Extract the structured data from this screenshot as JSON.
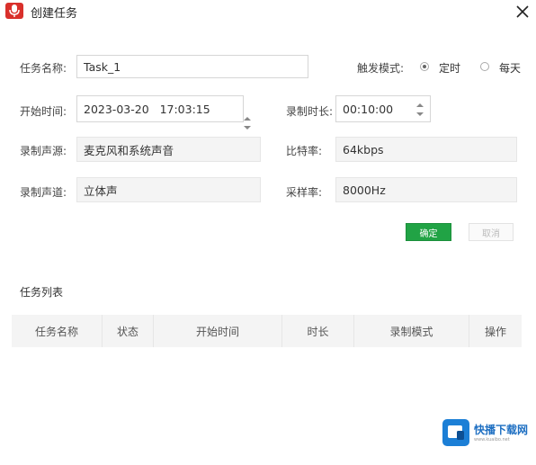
{
  "window": {
    "title": "创建任务"
  },
  "form": {
    "task_name": {
      "label": "任务名称:",
      "value": "Task_1"
    },
    "trigger": {
      "label": "触发模式:",
      "options": [
        "定时",
        "每天"
      ],
      "selected": "定时"
    },
    "start_time": {
      "label": "开始时间:",
      "value": "2023-03-20   17:03:15"
    },
    "duration": {
      "label": "录制时长:",
      "value": "00:10:00"
    },
    "source": {
      "label": "录制声源:",
      "value": "麦克风和系统声音"
    },
    "bitrate": {
      "label": "比特率:",
      "value": "64kbps"
    },
    "channel": {
      "label": "录制声道:",
      "value": "立体声"
    },
    "samplerate": {
      "label": "采样率:",
      "value": "8000Hz"
    }
  },
  "buttons": {
    "ok": "确定",
    "cancel": "取消"
  },
  "task_list": {
    "title": "任务列表",
    "columns": [
      "任务名称",
      "状态",
      "开始时间",
      "时长",
      "录制模式",
      "操作"
    ]
  },
  "watermark": {
    "name": "快播下载网",
    "url": "www.kuaibo.net"
  },
  "colors": {
    "accent_green": "#21a345",
    "app_red": "#d9302b",
    "watermark_blue": "#1c7fd6"
  }
}
